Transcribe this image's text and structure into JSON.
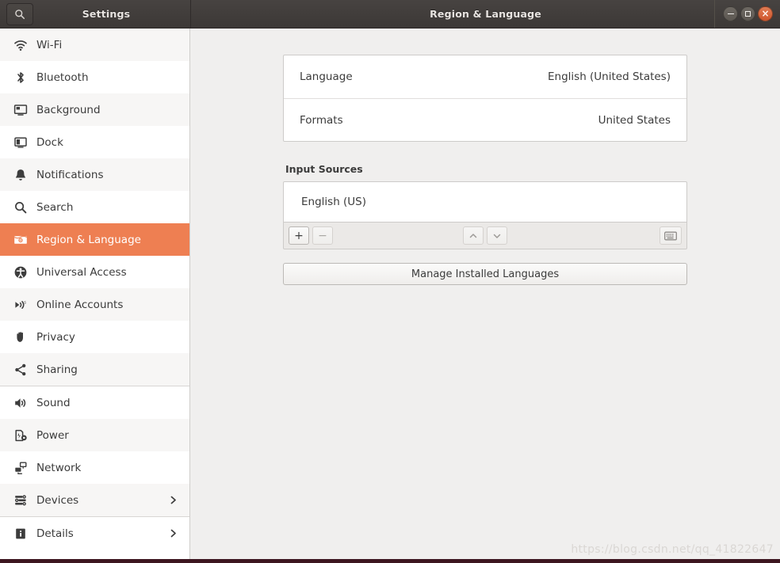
{
  "window": {
    "sidebar_title": "Settings",
    "main_title": "Region & Language",
    "search_icon": "search-icon",
    "controls": {
      "minimize": "minimize-icon",
      "maximize": "maximize-icon",
      "close": "close-icon",
      "close_glyph": "×"
    }
  },
  "sidebar": {
    "items": [
      {
        "label": "Wi-Fi",
        "icon": "wifi-icon",
        "selected": false,
        "chevron": false
      },
      {
        "label": "Bluetooth",
        "icon": "bluetooth-icon",
        "selected": false,
        "chevron": false
      },
      {
        "label": "Background",
        "icon": "background-icon",
        "selected": false,
        "chevron": false
      },
      {
        "label": "Dock",
        "icon": "dock-icon",
        "selected": false,
        "chevron": false
      },
      {
        "label": "Notifications",
        "icon": "bell-icon",
        "selected": false,
        "chevron": false
      },
      {
        "label": "Search",
        "icon": "search-icon",
        "selected": false,
        "chevron": false
      },
      {
        "label": "Region & Language",
        "icon": "region-language-icon",
        "selected": true,
        "chevron": false
      },
      {
        "label": "Universal Access",
        "icon": "accessibility-icon",
        "selected": false,
        "chevron": false
      },
      {
        "label": "Online Accounts",
        "icon": "online-accounts-icon",
        "selected": false,
        "chevron": false
      },
      {
        "label": "Privacy",
        "icon": "hand-icon",
        "selected": false,
        "chevron": false
      },
      {
        "label": "Sharing",
        "icon": "share-icon",
        "selected": false,
        "chevron": false
      },
      {
        "label": "Sound",
        "icon": "speaker-icon",
        "selected": false,
        "chevron": false
      },
      {
        "label": "Power",
        "icon": "power-icon",
        "selected": false,
        "chevron": false
      },
      {
        "label": "Network",
        "icon": "network-icon",
        "selected": false,
        "chevron": false
      },
      {
        "label": "Devices",
        "icon": "devices-icon",
        "selected": false,
        "chevron": true
      },
      {
        "label": "Details",
        "icon": "info-icon",
        "selected": false,
        "chevron": true
      }
    ]
  },
  "main": {
    "settings_rows": [
      {
        "label": "Language",
        "value": "English (United States)"
      },
      {
        "label": "Formats",
        "value": "United States"
      }
    ],
    "input_sources": {
      "section_title": "Input Sources",
      "sources": [
        {
          "label": "English (US)"
        }
      ],
      "toolbar": {
        "add_label": "+",
        "remove_label": "−",
        "move_up": "chevron-up-icon",
        "move_down": "chevron-down-icon",
        "keyboard": "keyboard-icon"
      }
    },
    "manage_languages_label": "Manage Installed Languages"
  },
  "watermark": {
    "text": "https://blog.csdn.net/qq_41822647"
  },
  "colors": {
    "accent": "#ee7f52",
    "close_button": "#d0562c",
    "titlebar": "#3c3836",
    "content_bg": "#f0efee",
    "bottom_bar": "#3d1620"
  }
}
